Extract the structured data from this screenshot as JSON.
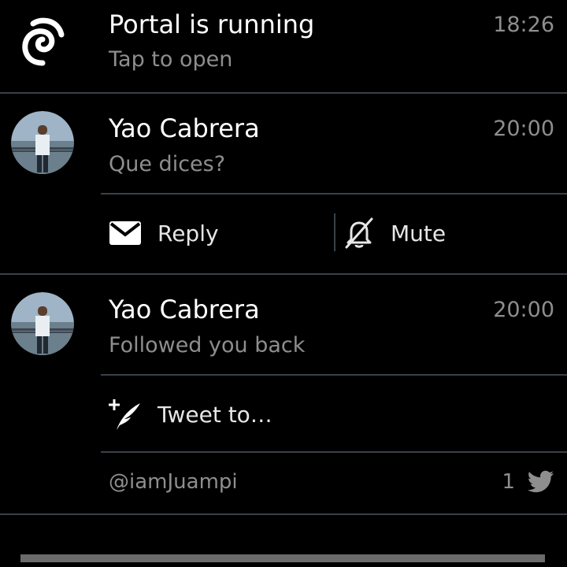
{
  "notifications": [
    {
      "title": "Portal is running",
      "subtitle": "Tap to open",
      "time": "18:26",
      "icon": "portal-swirl-icon"
    },
    {
      "title": "Yao Cabrera",
      "subtitle": "Que dices?",
      "time": "20:00",
      "icon": "avatar-photo",
      "actions": [
        {
          "label": "Reply",
          "icon": "envelope-icon"
        },
        {
          "label": "Mute",
          "icon": "bell-off-icon"
        }
      ]
    },
    {
      "title": "Yao Cabrera",
      "subtitle": "Followed you back",
      "time": "20:00",
      "icon": "avatar-photo",
      "actions": [
        {
          "label": "Tweet to…",
          "icon": "compose-quill-icon"
        }
      ],
      "footer": {
        "account": "@iamJuampi",
        "count": "1",
        "icon": "twitter-bird-icon"
      }
    }
  ],
  "colors": {
    "background": "#000000",
    "title": "#ffffff",
    "secondary": "#8e8e8e",
    "divider": "#3a4148"
  }
}
